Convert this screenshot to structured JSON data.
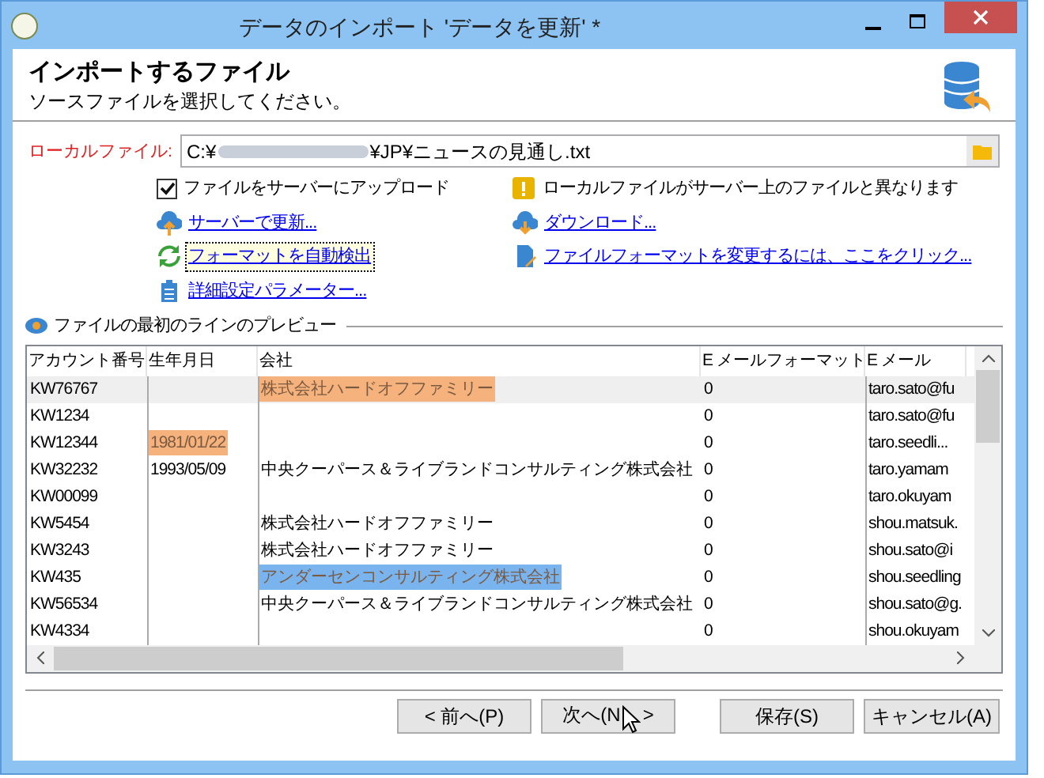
{
  "window": {
    "title": "データのインポート 'データを更新' *"
  },
  "header": {
    "title": "インポートするファイル",
    "subtitle": "ソースファイルを選択してください。"
  },
  "file": {
    "label": "ローカルファイル:",
    "path_start": "C:¥",
    "path_end": "¥JP¥ニュースの見通し.txt"
  },
  "upload": {
    "label": "ファイルをサーバーにアップロード",
    "checked": true
  },
  "warning": "ローカルファイルがサーバー上のファイルと異なります",
  "links": [
    {
      "kind": "upload",
      "text": "サーバーで更新...",
      "focused": false
    },
    {
      "kind": "download",
      "text": "ダウンロード...",
      "focused": false
    },
    {
      "kind": "refresh",
      "text": "フォーマットを自動検出",
      "focused": true
    },
    {
      "kind": "edit",
      "text": "ファイルフォーマットを変更するには、ここをクリック...",
      "focused": false
    },
    {
      "kind": "params",
      "text": "詳細設定パラメーター...",
      "focused": false
    }
  ],
  "preview": {
    "title": "ファイルの最初のラインのプレビュー"
  },
  "table": {
    "columns": [
      "アカウント番号",
      "生年月日",
      "会社",
      "E メールフォーマット",
      "E メール"
    ],
    "rows": [
      {
        "selected": true,
        "cells": [
          "KW76767",
          "",
          {
            "text": "株式会社ハードオフファミリー",
            "color": "#f5b27c"
          },
          "0",
          "taro.sato@fu"
        ]
      },
      {
        "selected": false,
        "cells": [
          "KW1234",
          "",
          "",
          "0",
          "taro.sato@fu"
        ]
      },
      {
        "selected": false,
        "cells": [
          "KW12344",
          {
            "text": "1981/01/22",
            "color": "#f5b27c"
          },
          "",
          "0",
          "taro.seedli..."
        ]
      },
      {
        "selected": false,
        "cells": [
          "KW32232",
          "1993/05/09",
          "中央クーパース＆ライブランドコンサルティング株式会社",
          "0",
          "taro.yamam"
        ]
      },
      {
        "selected": false,
        "cells": [
          "KW00099",
          "",
          "",
          "0",
          "taro.okuyam"
        ]
      },
      {
        "selected": false,
        "cells": [
          "KW5454",
          "",
          "株式会社ハードオフファミリー",
          "0",
          "shou.matsuk."
        ]
      },
      {
        "selected": false,
        "cells": [
          "KW3243",
          "",
          "株式会社ハードオフファミリー",
          "0",
          "shou.sato@i"
        ]
      },
      {
        "selected": false,
        "cells": [
          "KW435",
          "",
          {
            "text": "アンダーセンコンサルティング株式会社",
            "color": "#7ab4ef"
          },
          "0",
          "shou.seedling"
        ]
      },
      {
        "selected": false,
        "cells": [
          "KW56534",
          "",
          "中央クーパース＆ライブランドコンサルティング株式会社",
          "0",
          "shou.sato@g."
        ]
      },
      {
        "selected": false,
        "cells": [
          "KW4334",
          "",
          "",
          "0",
          "shou.okuyam"
        ]
      }
    ]
  },
  "buttons": [
    {
      "label": "< 前へ(P)"
    },
    {
      "label": "次へ(N",
      "tail": ">"
    },
    {
      "label": "保存(S)"
    },
    {
      "label": "キャンセル(A)"
    }
  ]
}
